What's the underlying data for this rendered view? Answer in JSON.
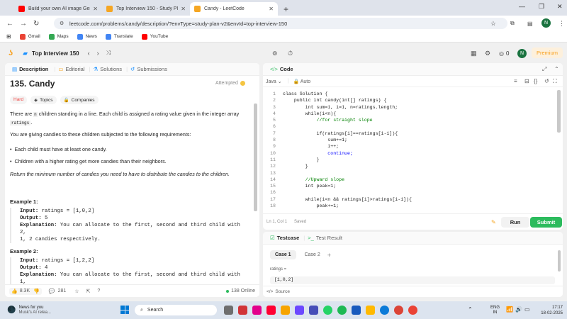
{
  "browser": {
    "tabs": [
      {
        "title": "Build your own AI image Gene",
        "color": "#ff0000"
      },
      {
        "title": "Top Interview 150 - Study Plan",
        "color": "#f5a623"
      },
      {
        "title": "Candy - LeetCode",
        "color": "#f5a623"
      }
    ],
    "new_tab": "+",
    "url": "leetcode.com/problems/candy/description/?envType=study-plan-v2&envId=top-interview-150",
    "bookmarks": [
      "Gmail",
      "Maps",
      "News",
      "Translate",
      "YouTube"
    ],
    "profile_initial": "N"
  },
  "lc": {
    "plan_title": "Top Interview 150",
    "streak": "0",
    "avatar": "N",
    "premium": "Premium"
  },
  "desc": {
    "tabs": [
      "Description",
      "Editorial",
      "Solutions",
      "Submissions"
    ],
    "title": "135. Candy",
    "status": "Attempted",
    "difficulty": "Hard",
    "topics": "Topics",
    "companies": "Companies",
    "p1a": "There are ",
    "p1n": "n",
    "p1b": " children standing in a line. Each child is assigned a rating value given in the integer array",
    "p1c": "ratings",
    "p1d": ".",
    "p2": "You are giving candies to these children subjected to the following requirements:",
    "b1": "Each child must have at least one candy.",
    "b2": "Children with a higher rating get more candies than their neighbors.",
    "p3": "Return the minimum number of candies you need to have to distribute the candies to the children.",
    "ex1_title": "Example 1:",
    "ex1_input_label": "Input:",
    "ex1_input": " ratings = [1,0,2]",
    "ex1_output_label": "Output:",
    "ex1_output": " 5",
    "ex1_expl_label": "Explanation:",
    "ex1_expl": " You can allocate to the first, second and third child with 2,",
    "ex1_expl2": "1, 2 candies respectively.",
    "ex2_title": "Example 2:",
    "ex2_input_label": "Input:",
    "ex2_input": " ratings = [1,2,2]",
    "ex2_output_label": "Output:",
    "ex2_output": " 4",
    "ex2_expl_label": "Explanation:",
    "ex2_expl": " You can allocate to the first, second and third child with 1,",
    "likes": "8.3K",
    "comments": "281",
    "online": "138 Online"
  },
  "code": {
    "title": "Code",
    "lang": "Java",
    "auto": "Auto",
    "lines": [
      {
        "n": "1",
        "t": "class Solution {"
      },
      {
        "n": "2",
        "t": "    public int candy(int[] ratings) {"
      },
      {
        "n": "3",
        "t": "        int sum=1, i=1, n=ratings.length;"
      },
      {
        "n": "4",
        "t": "        while(i<n){"
      },
      {
        "n": "5",
        "t": "            //for straight slope"
      },
      {
        "n": "6",
        "t": ""
      },
      {
        "n": "7",
        "t": "            if(ratings[i]==ratings[i-1]){"
      },
      {
        "n": "8",
        "t": "                sum+=1;"
      },
      {
        "n": "9",
        "t": "                i++;"
      },
      {
        "n": "10",
        "t": "                continue;"
      },
      {
        "n": "11",
        "t": "            }"
      },
      {
        "n": "12",
        "t": "        }"
      },
      {
        "n": "13",
        "t": ""
      },
      {
        "n": "14",
        "t": "        //Upward slope"
      },
      {
        "n": "15",
        "t": "        int peak=1;"
      },
      {
        "n": "16",
        "t": ""
      },
      {
        "n": "17",
        "t": "        while(i<n && ratings[i]>ratings[i-1]){"
      },
      {
        "n": "18",
        "t": "            peak+=1;"
      }
    ],
    "status": "Ln 1, Col 1",
    "saved": "Saved",
    "run": "Run",
    "submit": "Submit"
  },
  "test": {
    "tabs": [
      "Testcase",
      "Test Result"
    ],
    "cases": [
      "Case 1",
      "Case 2"
    ],
    "add": "+",
    "label": "ratings =",
    "value": "[1,0,2]",
    "source": "Source"
  },
  "taskbar": {
    "news_title": "News for you",
    "news_sub": "Musk's AI relea...",
    "search": "Search",
    "lang1": "ENG",
    "lang2": "IN",
    "time": "17:17",
    "date": "18-02-2025"
  }
}
